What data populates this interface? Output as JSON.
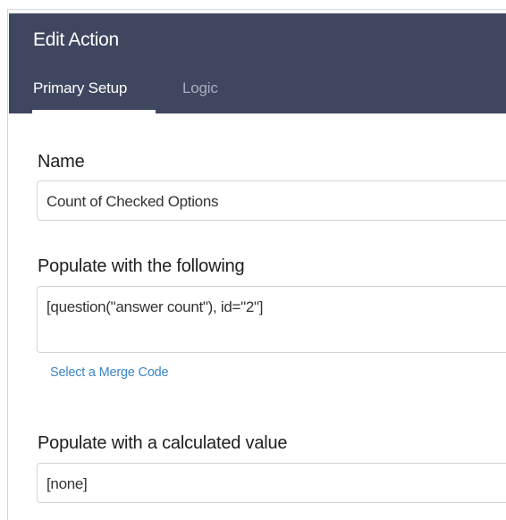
{
  "dialog": {
    "title": "Edit Action",
    "tabs": [
      {
        "label": "Primary Setup",
        "active": true
      },
      {
        "label": "Logic",
        "active": false
      }
    ]
  },
  "form": {
    "name": {
      "label": "Name",
      "value": "Count of Checked Options"
    },
    "populate_following": {
      "label": "Populate with the following",
      "value": "[question(\"answer count\"), id=\"2\"]",
      "merge_code_link": "Select a Merge Code"
    },
    "populate_calculated": {
      "label": "Populate with a calculated value",
      "value": "[none]"
    }
  },
  "colors": {
    "header_bg": "#3f4760",
    "active_tab": "#ffffff",
    "inactive_tab": "#a7adbd",
    "link": "#3b86c4"
  }
}
